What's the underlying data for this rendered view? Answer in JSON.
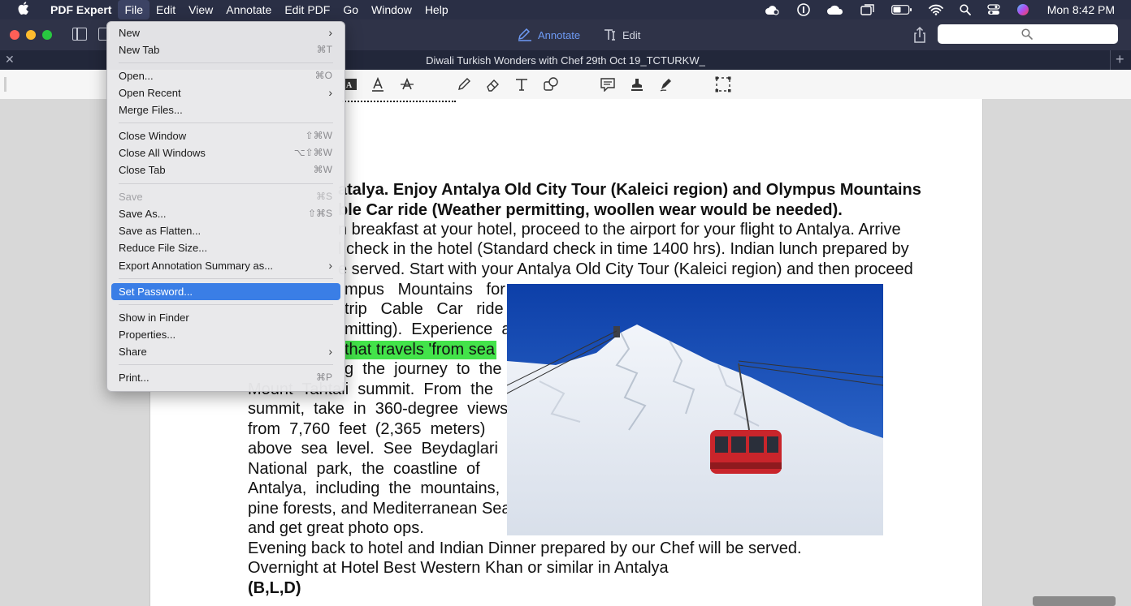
{
  "menubar": {
    "app_name": "PDF Expert",
    "menus": [
      "File",
      "Edit",
      "View",
      "Annotate",
      "Edit PDF",
      "Go",
      "Window",
      "Help"
    ],
    "clock": "Mon 8:42 PM",
    "status_icons": [
      "creative-cloud-icon",
      "1password-icon",
      "cloud-icon",
      "screens-icon",
      "battery-icon",
      "wifi-icon",
      "spotlight-icon",
      "control-center-icon",
      "siri-icon"
    ]
  },
  "toolbar": {
    "annotate_label": "Annotate",
    "edit_label": "Edit",
    "accent": "#6e9bf5"
  },
  "tab": {
    "title": "Diwali Turkish Wonders with Chef 29th Oct 19_TCTURKW_"
  },
  "file_menu": {
    "items": [
      {
        "label": "New",
        "shortcut": "",
        "submenu": true
      },
      {
        "label": "New Tab",
        "shortcut": "⌘T"
      },
      {
        "label": "Open...",
        "shortcut": "⌘O"
      },
      {
        "label": "Open Recent",
        "shortcut": "",
        "submenu": true
      },
      {
        "label": "Merge Files...",
        "shortcut": ""
      },
      {
        "label": "Close Window",
        "shortcut": "⇧⌘W"
      },
      {
        "label": "Close All Windows",
        "shortcut": "⌥⇧⌘W"
      },
      {
        "label": "Close Tab",
        "shortcut": "⌘W"
      },
      {
        "label": "Save",
        "shortcut": "⌘S",
        "disabled": true
      },
      {
        "label": "Save As...",
        "shortcut": "⇧⌘S"
      },
      {
        "label": "Save as Flatten...",
        "shortcut": ""
      },
      {
        "label": "Reduce File Size...",
        "shortcut": ""
      },
      {
        "label": "Export Annotation Summary as...",
        "shortcut": "",
        "submenu": true
      },
      {
        "label": "Set Password...",
        "shortcut": "",
        "selected": true
      },
      {
        "label": "Show in Finder",
        "shortcut": ""
      },
      {
        "label": "Properties...",
        "shortcut": ""
      },
      {
        "label": "Share",
        "shortcut": "",
        "submenu": true
      },
      {
        "label": "Print...",
        "shortcut": "⌘P"
      }
    ]
  },
  "document": {
    "lines": [
      "atalya. Enjoy Antalya Old City Tour (Kaleici region) and Olympus Mountains",
      "ble Car ride (Weather permitting, woollen wear would be needed).",
      "n breakfast at your hotel, proceed to the airport for your flight to Antalya. Arrive",
      "l check in the hotel (Standard check in time 1400 hrs). Indian lunch prepared by",
      "e served. Start with your Antalya Old City Tour (Kaleici region) and then proceed",
      "mpus   Mountains   for",
      "trip   Cable   Car   ride",
      "mitting).  Experience  a",
      "that travels 'from sea",
      "g  the  journey  to  the",
      "Mount  Tahtali  summit.  From  the",
      "summit,  take  in  360-degree  views",
      "from  7,760  feet  (2,365  meters)",
      "above  sea  level.  See  Beydaglari",
      "National  park,  the  coastline  of",
      "Antalya,  including  the  mountains,",
      "pine forests, and Mediterranean Sea,",
      "and get great photo ops.",
      "Evening back to hotel and Indian Dinner prepared by our Chef will be served.",
      "Overnight at Hotel Best Western Khan or similar in Antalya",
      "(B,L,D)"
    ],
    "highlight_color": "#43e34a"
  }
}
